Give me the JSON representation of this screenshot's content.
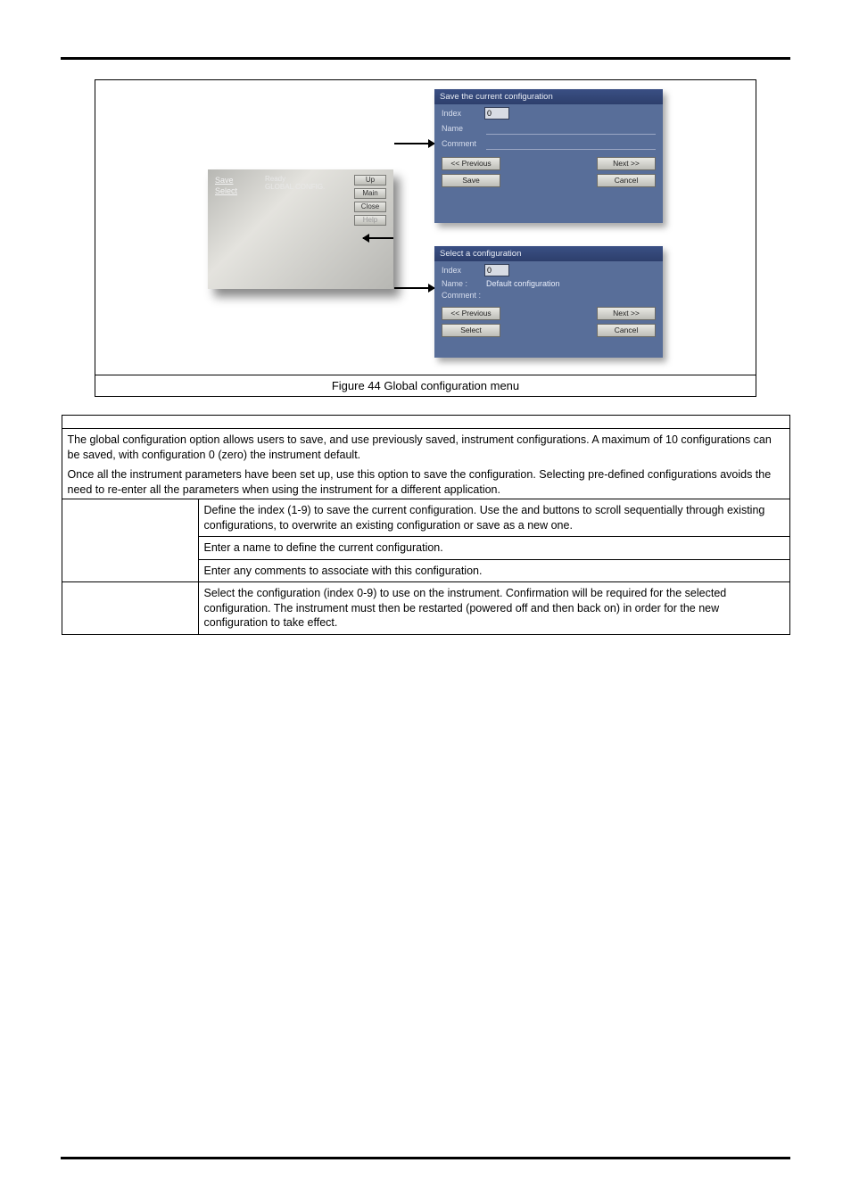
{
  "figure": {
    "caption": "Figure 44  Global configuration menu",
    "menu": {
      "status_label": "Ready",
      "status_line2": "GLOBAL CONFIG.",
      "items": [
        "Save",
        "Select"
      ],
      "buttons": {
        "up": "Up",
        "main": "Main",
        "close": "Close",
        "help": "Help"
      }
    },
    "save_dialog": {
      "title": "Save the current configuration",
      "labels": {
        "index": "Index",
        "name": "Name",
        "comment": "Comment"
      },
      "index_value": "0",
      "name_value": "",
      "comment_value": "",
      "buttons": {
        "prev": "<< Previous",
        "next": "Next >>",
        "save": "Save",
        "cancel": "Cancel"
      }
    },
    "select_dialog": {
      "title": "Select a configuration",
      "labels": {
        "index": "Index",
        "name": "Name :",
        "comment": "Comment :"
      },
      "index_value": "0",
      "name_value": "Default configuration",
      "comment_value": "",
      "buttons": {
        "prev": "<< Previous",
        "next": "Next >>",
        "select": "Select",
        "cancel": "Cancel"
      }
    }
  },
  "body": {
    "para1": "The global configuration option allows users to save, and use previously saved, instrument configurations. A maximum of 10 configurations can be saved, with configuration 0 (zero) the instrument default.",
    "para2": "Once all the instrument parameters have been set up, use this option to save the configuration. Selecting pre-defined configurations avoids the need to re-enter all the parameters when using the instrument for a different application.",
    "rows": {
      "save": {
        "index": "Define the index (1-9) to save the current configuration. Use the ",
        "index_mid": " and ",
        "index_tail": " buttons to scroll sequentially through existing configurations, to overwrite an existing configuration or save as a new one.",
        "name": "Enter a name to define the current configuration.",
        "comment": "Enter any comments to associate with this configuration."
      },
      "select": {
        "index": "Select the configuration (index 0-9) to use on the instrument. Confirmation will be required for the selected configuration. The instrument must then be restarted (powered off and then back on) in order for the new configuration to take effect."
      }
    }
  }
}
